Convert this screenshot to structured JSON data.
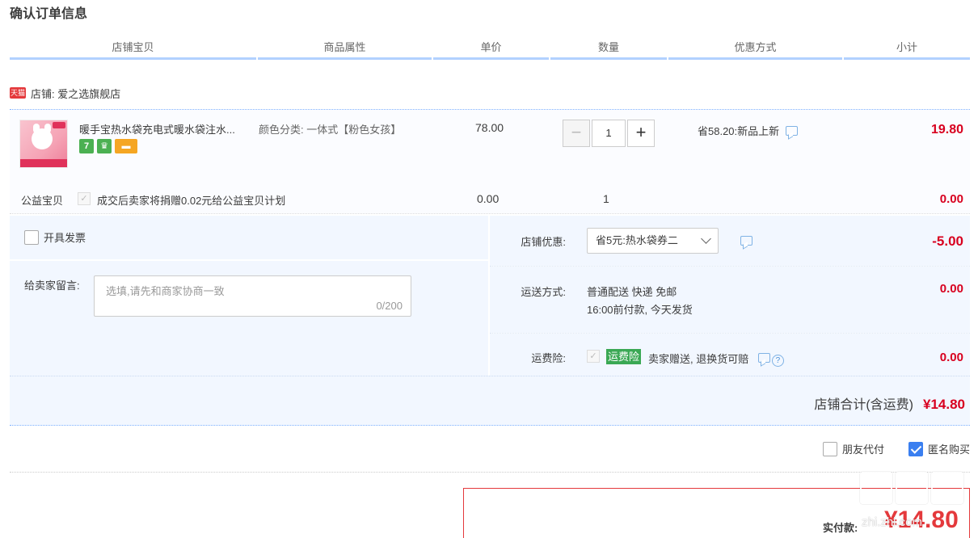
{
  "page": {
    "title": "确认订单信息"
  },
  "columns": [
    "店铺宝贝",
    "商品属性",
    "单价",
    "数量",
    "优惠方式",
    "小计"
  ],
  "shop": {
    "badge": "天猫",
    "label": "店铺: 爱之选旗舰店"
  },
  "item": {
    "title": "暖手宝热水袋充电式暖水袋注水...",
    "attribute": "颜色分类: 一体式【粉色女孩】",
    "price": "78.00",
    "quantity": "1",
    "minus_label": "−",
    "plus_label": "+",
    "discount": "省58.20:新品上新",
    "subtotal": "19.80",
    "service_icons": [
      "7",
      "cup-icon",
      "card-icon"
    ]
  },
  "charity": {
    "label": "公益宝贝",
    "text": "成交后卖家将捐赠0.02元给公益宝贝计划",
    "price": "0.00",
    "quantity": "1",
    "subtotal": "0.00"
  },
  "order": {
    "invoice_label": "开具发票",
    "message_label": "给卖家留言:",
    "message_placeholder": "选填,请先和商家协商一致",
    "message_count": "0/200",
    "coupon_label": "店铺优惠:",
    "coupon_selected": "省5元:热水袋券二",
    "coupon_value": "-5.00",
    "shipping_label": "运送方式:",
    "shipping_line1": "普通配送 快递 免邮",
    "shipping_line2": "16:00前付款, 今天发货",
    "shipping_value": "0.00",
    "insurance_label": "运费险:",
    "insurance_badge": "运费险",
    "insurance_text": "卖家赠送, 退换货可赔",
    "insurance_value": "0.00",
    "shop_total_label": "店铺合计(含运费)",
    "shop_total_value": "¥14.80"
  },
  "options": {
    "friend_pay": "朋友代付",
    "anonymous": "匿名购买"
  },
  "payment": {
    "label": "实付款:",
    "value": "¥14.80"
  },
  "watermark": {
    "text": "zhi.zhi.com"
  },
  "colors": {
    "accent_red": "#d8001f",
    "header_line": "#b2d1ff",
    "panel_bg": "#f2f7ff"
  }
}
